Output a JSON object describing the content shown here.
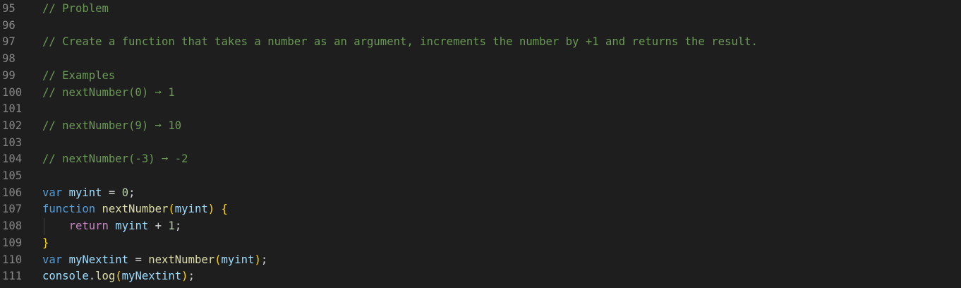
{
  "editor": {
    "lines": [
      {
        "number": "95",
        "tokens": [
          {
            "text": "// Problem",
            "type": "comment"
          }
        ]
      },
      {
        "number": "96",
        "tokens": []
      },
      {
        "number": "97",
        "tokens": [
          {
            "text": "// Create a function that takes a number as an argument, increments the number by +1 and returns the result.",
            "type": "comment"
          }
        ]
      },
      {
        "number": "98",
        "tokens": []
      },
      {
        "number": "99",
        "tokens": [
          {
            "text": "// Examples",
            "type": "comment"
          }
        ]
      },
      {
        "number": "100",
        "tokens": [
          {
            "text": "// nextNumber(0) ➞ 1",
            "type": "comment"
          }
        ]
      },
      {
        "number": "101",
        "tokens": []
      },
      {
        "number": "102",
        "tokens": [
          {
            "text": "// nextNumber(9) ➞ 10",
            "type": "comment"
          }
        ]
      },
      {
        "number": "103",
        "tokens": []
      },
      {
        "number": "104",
        "tokens": [
          {
            "text": "// nextNumber(-3) ➞ -2",
            "type": "comment"
          }
        ]
      },
      {
        "number": "105",
        "tokens": []
      },
      {
        "number": "106",
        "tokens": [
          {
            "text": "var",
            "type": "keyword"
          },
          {
            "text": " ",
            "type": "op"
          },
          {
            "text": "myint",
            "type": "var"
          },
          {
            "text": " = ",
            "type": "op"
          },
          {
            "text": "0",
            "type": "num"
          },
          {
            "text": ";",
            "type": "op"
          }
        ]
      },
      {
        "number": "107",
        "tokens": [
          {
            "text": "function",
            "type": "keyword"
          },
          {
            "text": " ",
            "type": "op"
          },
          {
            "text": "nextNumber",
            "type": "fn"
          },
          {
            "text": "(",
            "type": "brace"
          },
          {
            "text": "myint",
            "type": "var"
          },
          {
            "text": ")",
            "type": "brace"
          },
          {
            "text": " ",
            "type": "op"
          },
          {
            "text": "{",
            "type": "brace"
          }
        ]
      },
      {
        "number": "108",
        "tokens": [
          {
            "text": "    ",
            "type": "op"
          },
          {
            "text": "return",
            "type": "control"
          },
          {
            "text": " ",
            "type": "op"
          },
          {
            "text": "myint",
            "type": "var"
          },
          {
            "text": " + ",
            "type": "op"
          },
          {
            "text": "1",
            "type": "num"
          },
          {
            "text": ";",
            "type": "op"
          }
        ]
      },
      {
        "number": "109",
        "tokens": [
          {
            "text": "}",
            "type": "brace"
          }
        ]
      },
      {
        "number": "110",
        "tokens": [
          {
            "text": "var",
            "type": "keyword"
          },
          {
            "text": " ",
            "type": "op"
          },
          {
            "text": "myNextint",
            "type": "var"
          },
          {
            "text": " = ",
            "type": "op"
          },
          {
            "text": "nextNumber",
            "type": "fn"
          },
          {
            "text": "(",
            "type": "brace"
          },
          {
            "text": "myint",
            "type": "var"
          },
          {
            "text": ")",
            "type": "brace"
          },
          {
            "text": ";",
            "type": "op"
          }
        ]
      },
      {
        "number": "111",
        "tokens": [
          {
            "text": "console",
            "type": "var"
          },
          {
            "text": ".",
            "type": "op"
          },
          {
            "text": "log",
            "type": "fn"
          },
          {
            "text": "(",
            "type": "brace"
          },
          {
            "text": "myNextint",
            "type": "var"
          },
          {
            "text": ")",
            "type": "brace"
          },
          {
            "text": ";",
            "type": "op"
          }
        ]
      }
    ]
  },
  "colors": {
    "background": "#1e1e1e",
    "line_number": "#858585",
    "comment": "#6a9955",
    "keyword": "#569cd6",
    "control": "#c586c0",
    "variable": "#9cdcfe",
    "function": "#dcdcaa",
    "number": "#b5cea8",
    "operator": "#d4d4d4",
    "bracket": "#ffd700"
  }
}
